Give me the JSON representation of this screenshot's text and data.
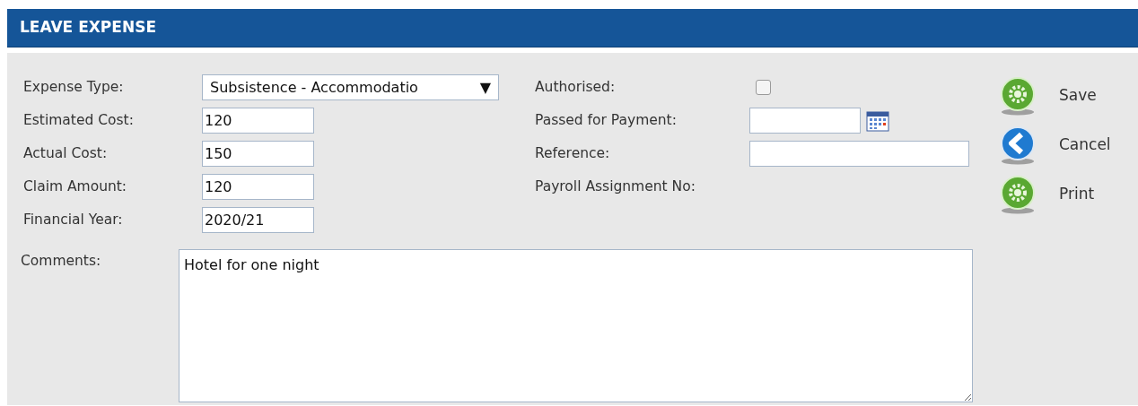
{
  "header": {
    "title": "LEAVE EXPENSE"
  },
  "left_fields": [
    {
      "label": "Expense Type:",
      "kind": "select",
      "value": "Subsistence - Accommodatio",
      "arrow": "▼"
    },
    {
      "label": "Estimated Cost:",
      "kind": "text",
      "value": "120"
    },
    {
      "label": "Actual Cost:",
      "kind": "text",
      "value": "150"
    },
    {
      "label": "Claim Amount:",
      "kind": "text",
      "value": "120"
    },
    {
      "label": "Financial Year:",
      "kind": "text",
      "value": "2020/21"
    }
  ],
  "right_fields": [
    {
      "label": "Authorised:",
      "kind": "checkbox",
      "checked": false
    },
    {
      "label": "Passed for Payment:",
      "kind": "date"
    },
    {
      "label": "Reference:",
      "kind": "wide"
    },
    {
      "label": "Payroll Assignment No:",
      "kind": "plain"
    }
  ],
  "actions": [
    {
      "label": "Save",
      "kind": "gear"
    },
    {
      "label": "Cancel",
      "kind": "back"
    },
    {
      "label": "Print",
      "kind": "gear"
    }
  ],
  "comments": {
    "label": "Comments:",
    "value": "Hotel for one night"
  }
}
